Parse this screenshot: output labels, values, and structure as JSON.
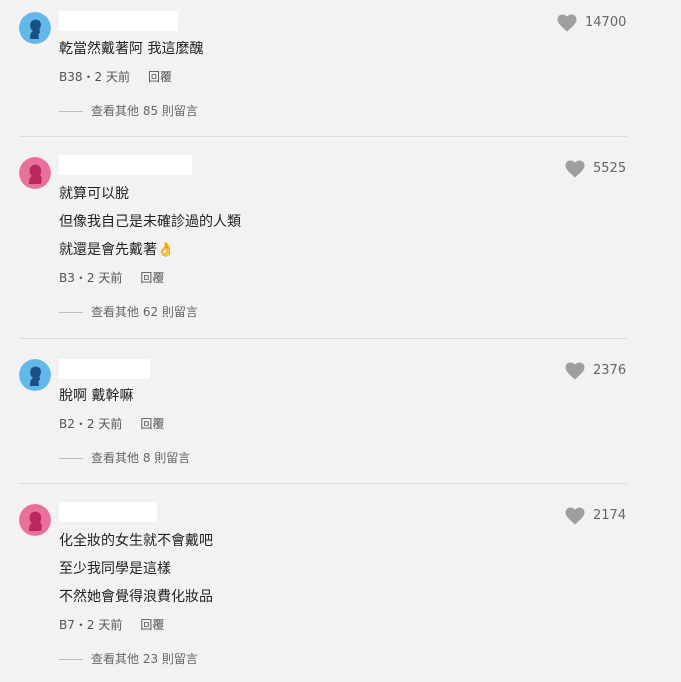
{
  "comments": [
    {
      "lines": [
        "乾當然戴著阿 我這麼醜"
      ],
      "floor": "B38",
      "time": "2 天前",
      "reply_label": "回覆",
      "likes": "14700",
      "more_replies": "查看其他 85 則留言",
      "avatar_color": "#62b8e8"
    },
    {
      "lines": [
        "就算可以脫",
        "但像我自己是未確診過的人類",
        "就還是會先戴著👌"
      ],
      "floor": "B3",
      "time": "2 天前",
      "reply_label": "回覆",
      "likes": "5525",
      "more_replies": "查看其他 62 則留言",
      "avatar_color": "#e8709a"
    },
    {
      "lines": [
        "脫啊 戴幹嘛"
      ],
      "floor": "B2",
      "time": "2 天前",
      "reply_label": "回覆",
      "likes": "2376",
      "more_replies": "查看其他 8 則留言",
      "avatar_color": "#62b8e8"
    },
    {
      "lines": [
        "化全妝的女生就不會戴吧",
        "至少我同學是這樣",
        "不然她會覺得浪費化妝品"
      ],
      "floor": "B7",
      "time": "2 天前",
      "reply_label": "回覆",
      "likes": "2174",
      "more_replies": "查看其他 23 則留言",
      "avatar_color": "#e8709a"
    }
  ],
  "separator": "・"
}
